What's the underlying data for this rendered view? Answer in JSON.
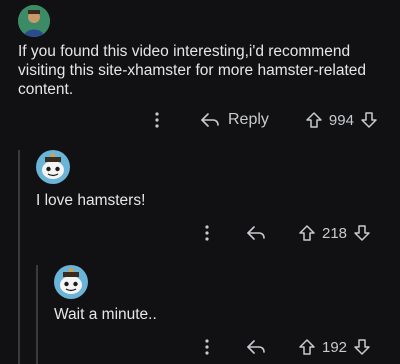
{
  "comments": [
    {
      "text": "If you found this video interesting,i'd recommend visiting this site-xhamster for more hamster-related content.",
      "reply_label": "Reply",
      "score": "994"
    },
    {
      "text": "I love hamsters!",
      "score": "218"
    },
    {
      "text": "Wait a minute..",
      "score": "192"
    }
  ],
  "icons": {
    "more": "more-vertical-icon",
    "reply": "reply-arrow-icon",
    "upvote": "upvote-arrow-icon",
    "downvote": "downvote-arrow-icon"
  },
  "colors": {
    "background": "#111113",
    "avatar_primary_bg": "#2e7d5a",
    "avatar_snoo_bg": "#6ab4d8"
  }
}
